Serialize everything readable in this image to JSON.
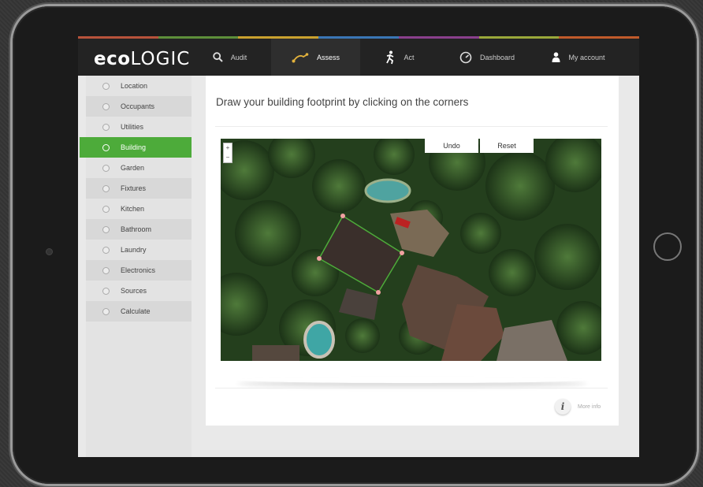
{
  "app": {
    "logo_bold": "eco",
    "logo_light": "LOGIC"
  },
  "nav": [
    {
      "label": "Audit",
      "icon": "search-icon"
    },
    {
      "label": "Assess",
      "icon": "assess-icon",
      "active": true
    },
    {
      "label": "Act",
      "icon": "act-icon"
    },
    {
      "label": "Dashboard",
      "icon": "gauge-icon"
    },
    {
      "label": "My account",
      "icon": "user-icon"
    }
  ],
  "strip_colors": [
    "#b8533b",
    "#5d8f3a",
    "#c9a12e",
    "#3a76b5",
    "#8a3f8c",
    "#9aa83a",
    "#c05a2a"
  ],
  "sidebar": {
    "items": [
      {
        "label": "Location"
      },
      {
        "label": "Occupants"
      },
      {
        "label": "Utilities"
      },
      {
        "label": "Building",
        "active": true
      },
      {
        "label": "Garden"
      },
      {
        "label": "Fixtures"
      },
      {
        "label": "Kitchen"
      },
      {
        "label": "Bathroom"
      },
      {
        "label": "Laundry"
      },
      {
        "label": "Electronics"
      },
      {
        "label": "Sources"
      },
      {
        "label": "Calculate"
      }
    ]
  },
  "main": {
    "heading": "Draw your building footprint by clicking on the corners",
    "undo_label": "Undo",
    "reset_label": "Reset",
    "zoom_in": "+",
    "zoom_out": "−",
    "more_info": "More info",
    "info_glyph": "i"
  },
  "colors": {
    "accent_green": "#4dab3a",
    "topbar": "#232323"
  }
}
